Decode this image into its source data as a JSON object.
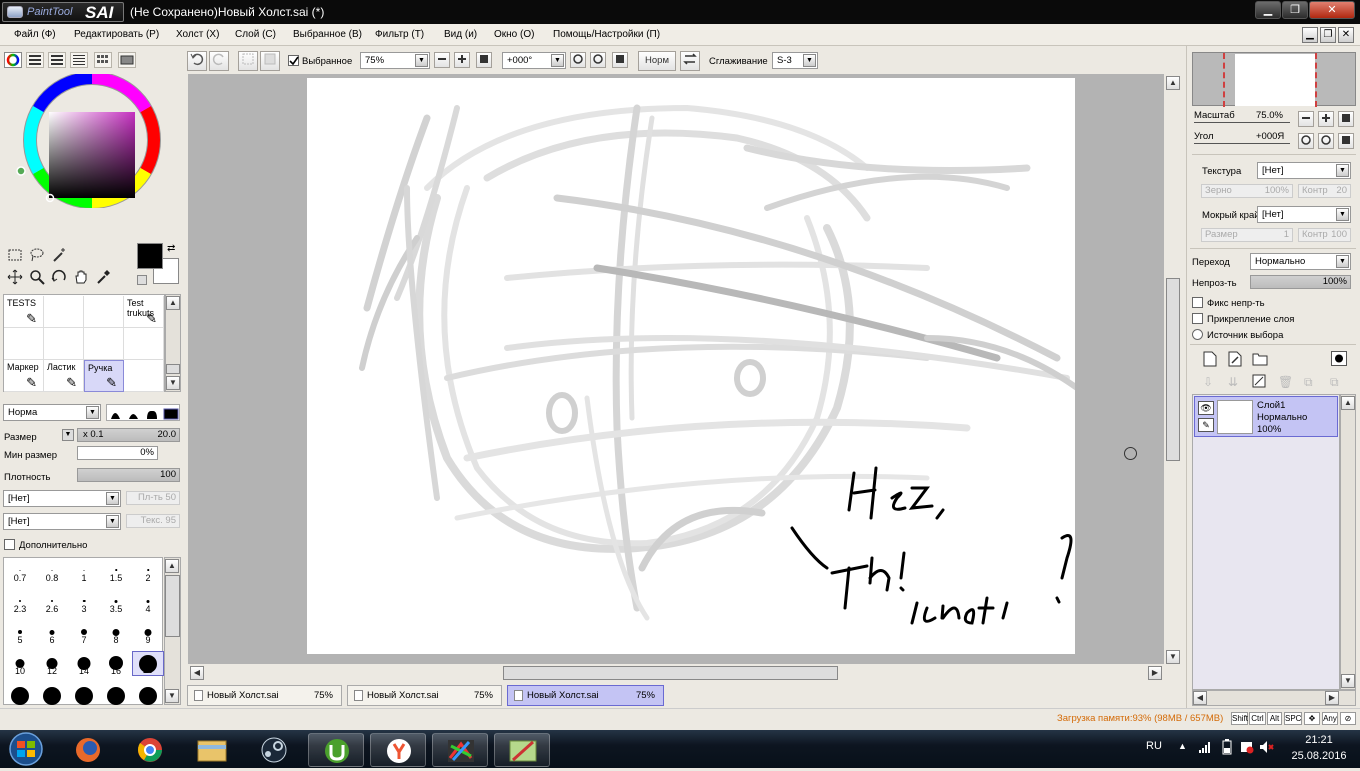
{
  "window": {
    "title": "(Не Сохранено)Новый Холст.sai (*)",
    "logo_small": "PaintTool",
    "logo_big": "SAI",
    "minimize": "▁",
    "maximize": "❐",
    "close": "✕"
  },
  "menu": [
    "Файл (Ф)",
    "Редактировать (Р)",
    "Холст (Х)",
    "Слой (С)",
    "Выбранное (В)",
    "Фильтр (Т)",
    "Вид (и)",
    "Окно (О)",
    "Помощь/Настройки (П)"
  ],
  "mdi": {
    "minimize": "▁",
    "restore": "❐",
    "close": "✕"
  },
  "topbar": {
    "selected_label": "Выбранное",
    "selected_checked": true,
    "zoom_value": "75%",
    "angle_value": "+000°",
    "norm_label": "Норм",
    "smoothing_label": "Сглаживание",
    "smoothing_value": "S-3"
  },
  "left": {
    "brush_slots": [
      {
        "name": "TESTS",
        "col": 0,
        "row": 0,
        "selected": false
      },
      {
        "name": "Test trukuts",
        "col": 3,
        "row": 0,
        "selected": false
      },
      {
        "name": "Маркер",
        "col": 0,
        "row": 2,
        "selected": false
      },
      {
        "name": "Ластик",
        "col": 1,
        "row": 2,
        "selected": false
      },
      {
        "name": "Ручка",
        "col": 2,
        "row": 2,
        "selected": true
      }
    ],
    "blend_mode": "Норма",
    "size_label": "Размер",
    "size_mult": "x 0.1",
    "size_value": "20.0",
    "min_size_label": "Мин размер",
    "min_size_value": "0%",
    "density_label": "Плотность",
    "density_value": "100",
    "paper1": "[Нет]",
    "paper1_value": "Пл-ть  50",
    "paper2": "[Нет]",
    "paper2_value": "Текс.  95",
    "advanced_label": "Дополнительно",
    "brush_sizes": [
      {
        "label": "0.7",
        "d": 1
      },
      {
        "label": "0.8",
        "d": 1
      },
      {
        "label": "1",
        "d": 1
      },
      {
        "label": "1.5",
        "d": 1.5
      },
      {
        "label": "2",
        "d": 1.5
      },
      {
        "label": "2.3",
        "d": 2
      },
      {
        "label": "2.6",
        "d": 2
      },
      {
        "label": "3",
        "d": 2.5
      },
      {
        "label": "3.5",
        "d": 3
      },
      {
        "label": "4",
        "d": 3
      },
      {
        "label": "5",
        "d": 4
      },
      {
        "label": "6",
        "d": 5
      },
      {
        "label": "7",
        "d": 6
      },
      {
        "label": "8",
        "d": 7
      },
      {
        "label": "9",
        "d": 7
      },
      {
        "label": "10",
        "d": 9
      },
      {
        "label": "12",
        "d": 11
      },
      {
        "label": "14",
        "d": 13
      },
      {
        "label": "16",
        "d": 14
      },
      {
        "label": "20",
        "d": 18
      },
      {
        "label": "",
        "d": 18
      },
      {
        "label": "",
        "d": 18
      },
      {
        "label": "",
        "d": 18
      },
      {
        "label": "",
        "d": 18
      },
      {
        "label": "",
        "d": 18
      }
    ],
    "selected_size": "20"
  },
  "tabs": [
    {
      "name": "Новый Холст.sai",
      "zoom": "75%",
      "selected": false
    },
    {
      "name": "Новый Холст.sai",
      "zoom": "75%",
      "selected": false
    },
    {
      "name": "Новый Холст.sai",
      "zoom": "75%",
      "selected": true
    }
  ],
  "right": {
    "scale_label": "Масштаб",
    "scale_value": "75.0%",
    "angle_label": "Угол",
    "angle_value": "+000Я",
    "texture_label": "Текстура",
    "texture_value": "[Нет]",
    "grain_label": "Зерно",
    "grain_value": "100%",
    "contrast1_label": "Контр",
    "contrast1_value": "20",
    "wet_edge_label": "Мокрый край",
    "wet_edge_value": "[Нет]",
    "size_label": "Размер",
    "size_value": "1",
    "contrast2_label": "Контр",
    "contrast2_value": "100",
    "blend_label": "Переход",
    "blend_value": "Нормально",
    "opacity_label": "Непроз-ть",
    "opacity_value": "100%",
    "preserve_opacity": "Фикс непр-ть",
    "clipping": "Прикрепление слоя",
    "selection_source": "Источник выбора",
    "layer": {
      "name": "Слой1",
      "mode": "Нормально",
      "opacity": "100%"
    }
  },
  "status": {
    "memory": "Загрузка памяти:93% (98MB / 657MB)",
    "keys": [
      "Shift",
      "Ctrl",
      "Alt",
      "SPC",
      "✥",
      "Any",
      "⊘"
    ]
  },
  "taskbar": {
    "apps": [
      "firefox-icon",
      "chrome-icon",
      "explorer-icon",
      "steam-icon",
      "utorrent-icon",
      "yandex-icon",
      "desktop-app-icon",
      "paint-tool-sai-icon"
    ],
    "lang": "RU",
    "time": "21:21",
    "date": "25.08.2016"
  },
  "canvas": {
    "text_line1": "Hez,",
    "text_line2": "Th!",
    "text_line3": "иечот?"
  },
  "colors": {
    "accent": "#c4c4f4",
    "selected_border": "#6a6ad2",
    "status_text": "#d46b08",
    "primary_color": "#000000",
    "hue_marker": "#c52fc0"
  }
}
